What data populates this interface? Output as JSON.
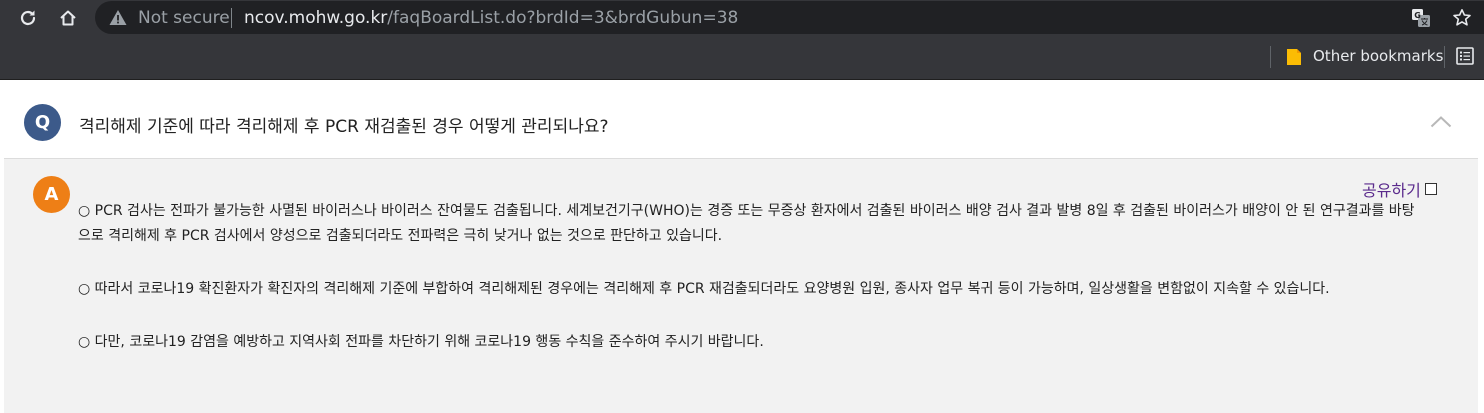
{
  "browser": {
    "security_label": "Not secure",
    "url_host": "ncov.mohw.go.kr",
    "url_path": "/faqBoardList.do?brdId=3&brdGubun=38",
    "bookmarks_label": "Other bookmarks",
    "chrome_color": "#35363a"
  },
  "faq": {
    "question_badge": "Q",
    "question_text": "격리해제 기준에 따라 격리해제 후 PCR 재검출된 경우 어떻게 관리되나요?",
    "answer_badge": "A",
    "share_label": "공유하기",
    "paragraphs": [
      "○ PCR 검사는 전파가 불가능한 사멸된 바이러스나 바이러스 잔여물도 검출됩니다. 세계보건기구(WHO)는 경증 또는 무증상 환자에서 검출된 바이러스 배양 검사 결과 발병 8일 후 검출된 바이러스가 배양이 안 된 연구결과를 바탕으로 격리해제 후 PCR 검사에서 양성으로 검출되더라도 전파력은 극히 낮거나 없는 것으로 판단하고 있습니다.",
      "○ 따라서 코로나19 확진환자가 확진자의 격리해제 기준에 부합하여 격리해제된 경우에는 격리해제 후 PCR 재검출되더라도 요양병원 입원, 종사자 업무 복귀 등이 가능하며, 일상생활을 변함없이 지속할 수 있습니다.",
      "○ 다만, 코로나19 감염을 예방하고 지역사회 전파를 차단하기 위해 코로나19 행동 수칙을 준수하여 주시기 바랍니다."
    ],
    "q_badge_color": "#3c5a8a",
    "a_badge_color": "#ee7f16",
    "answer_bg": "#f2f2f2"
  }
}
